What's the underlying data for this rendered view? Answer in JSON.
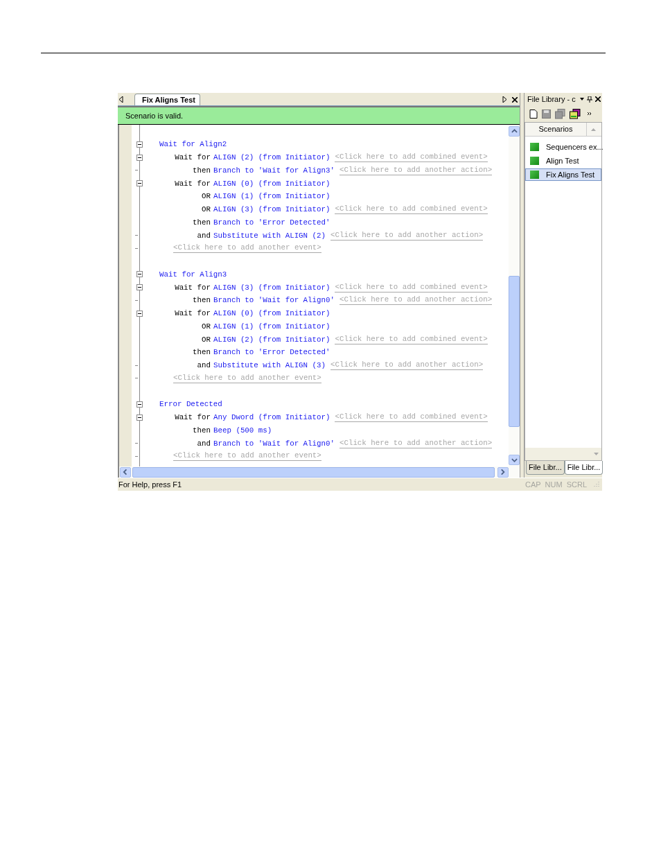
{
  "document_tab": {
    "label": "Fix Aligns Test",
    "selected": true
  },
  "validation": {
    "message": "Scenario is valid."
  },
  "groups": [
    {
      "title": "Wait for Align2",
      "expanded": true,
      "lines": [
        {
          "kind": "node",
          "expanded": true,
          "keyword": "Wait for",
          "text": "ALIGN (2) (from Initiator)",
          "hint": "<Click here to add combined event>"
        },
        {
          "kind": "leaf",
          "keyword": "then",
          "text": "Branch to 'Wait for Align3'",
          "hint": "<Click here to add another action>"
        },
        {
          "kind": "node",
          "expanded": true,
          "keyword": "Wait for",
          "text": "ALIGN (0) (from Initiator)"
        },
        {
          "kind": "none",
          "keyword": "OR",
          "text": "ALIGN (1) (from Initiator)"
        },
        {
          "kind": "none",
          "keyword": "OR",
          "text": "ALIGN (3) (from Initiator)",
          "hint": "<Click here to add combined event>"
        },
        {
          "kind": "none",
          "keyword": "then",
          "text": "Branch to 'Error Detected'"
        },
        {
          "kind": "leaf",
          "keyword": "and",
          "text": "Substitute with ALIGN (2)",
          "hint": "<Click here to add another action>"
        },
        {
          "kind": "leaf",
          "hint": "<Click here to add another event>"
        }
      ]
    },
    {
      "title": "Wait for Align3",
      "expanded": true,
      "lines": [
        {
          "kind": "node",
          "expanded": true,
          "keyword": "Wait for",
          "text": "ALIGN (3) (from Initiator)",
          "hint": "<Click here to add combined event>"
        },
        {
          "kind": "leaf",
          "keyword": "then",
          "text": "Branch to 'Wait for Align0'",
          "hint": "<Click here to add another action>"
        },
        {
          "kind": "node",
          "expanded": true,
          "keyword": "Wait for",
          "text": "ALIGN (0) (from Initiator)"
        },
        {
          "kind": "none",
          "keyword": "OR",
          "text": "ALIGN (1) (from Initiator)"
        },
        {
          "kind": "none",
          "keyword": "OR",
          "text": "ALIGN (2) (from Initiator)",
          "hint": "<Click here to add combined event>"
        },
        {
          "kind": "none",
          "keyword": "then",
          "text": "Branch to 'Error Detected'"
        },
        {
          "kind": "leaf",
          "keyword": "and",
          "text": "Substitute with ALIGN (3)",
          "hint": "<Click here to add another action>"
        },
        {
          "kind": "leaf",
          "hint": "<Click here to add another event>"
        }
      ]
    },
    {
      "title": "Error Detected",
      "expanded": true,
      "lines": [
        {
          "kind": "node",
          "expanded": true,
          "keyword": "Wait for",
          "text": "Any Dword (from Initiator)",
          "hint": "<Click here to add combined event>"
        },
        {
          "kind": "none",
          "keyword": "then",
          "text": "Beep (500 ms)"
        },
        {
          "kind": "leaf",
          "keyword": "and",
          "text": "Branch to 'Wait for Align0'",
          "hint": "<Click here to add another action>"
        },
        {
          "kind": "leaf",
          "hint": "<Click here to add another event>"
        }
      ]
    }
  ],
  "file_library": {
    "title": "File Library - c",
    "column": "Scenarios",
    "items": [
      {
        "label": "Sequencers ex...",
        "selected": false
      },
      {
        "label": "Align Test",
        "selected": false
      },
      {
        "label": "Fix Aligns Test",
        "selected": true
      }
    ],
    "tabs": [
      {
        "label": "File Libr...",
        "selected": false
      },
      {
        "label": "File Libr...",
        "selected": true
      }
    ]
  },
  "status_bar": {
    "help": "For Help, press F1",
    "indicators": [
      {
        "label": "CAP",
        "on": false
      },
      {
        "label": "NUM",
        "on": false
      },
      {
        "label": "SCRL",
        "on": false
      }
    ]
  }
}
